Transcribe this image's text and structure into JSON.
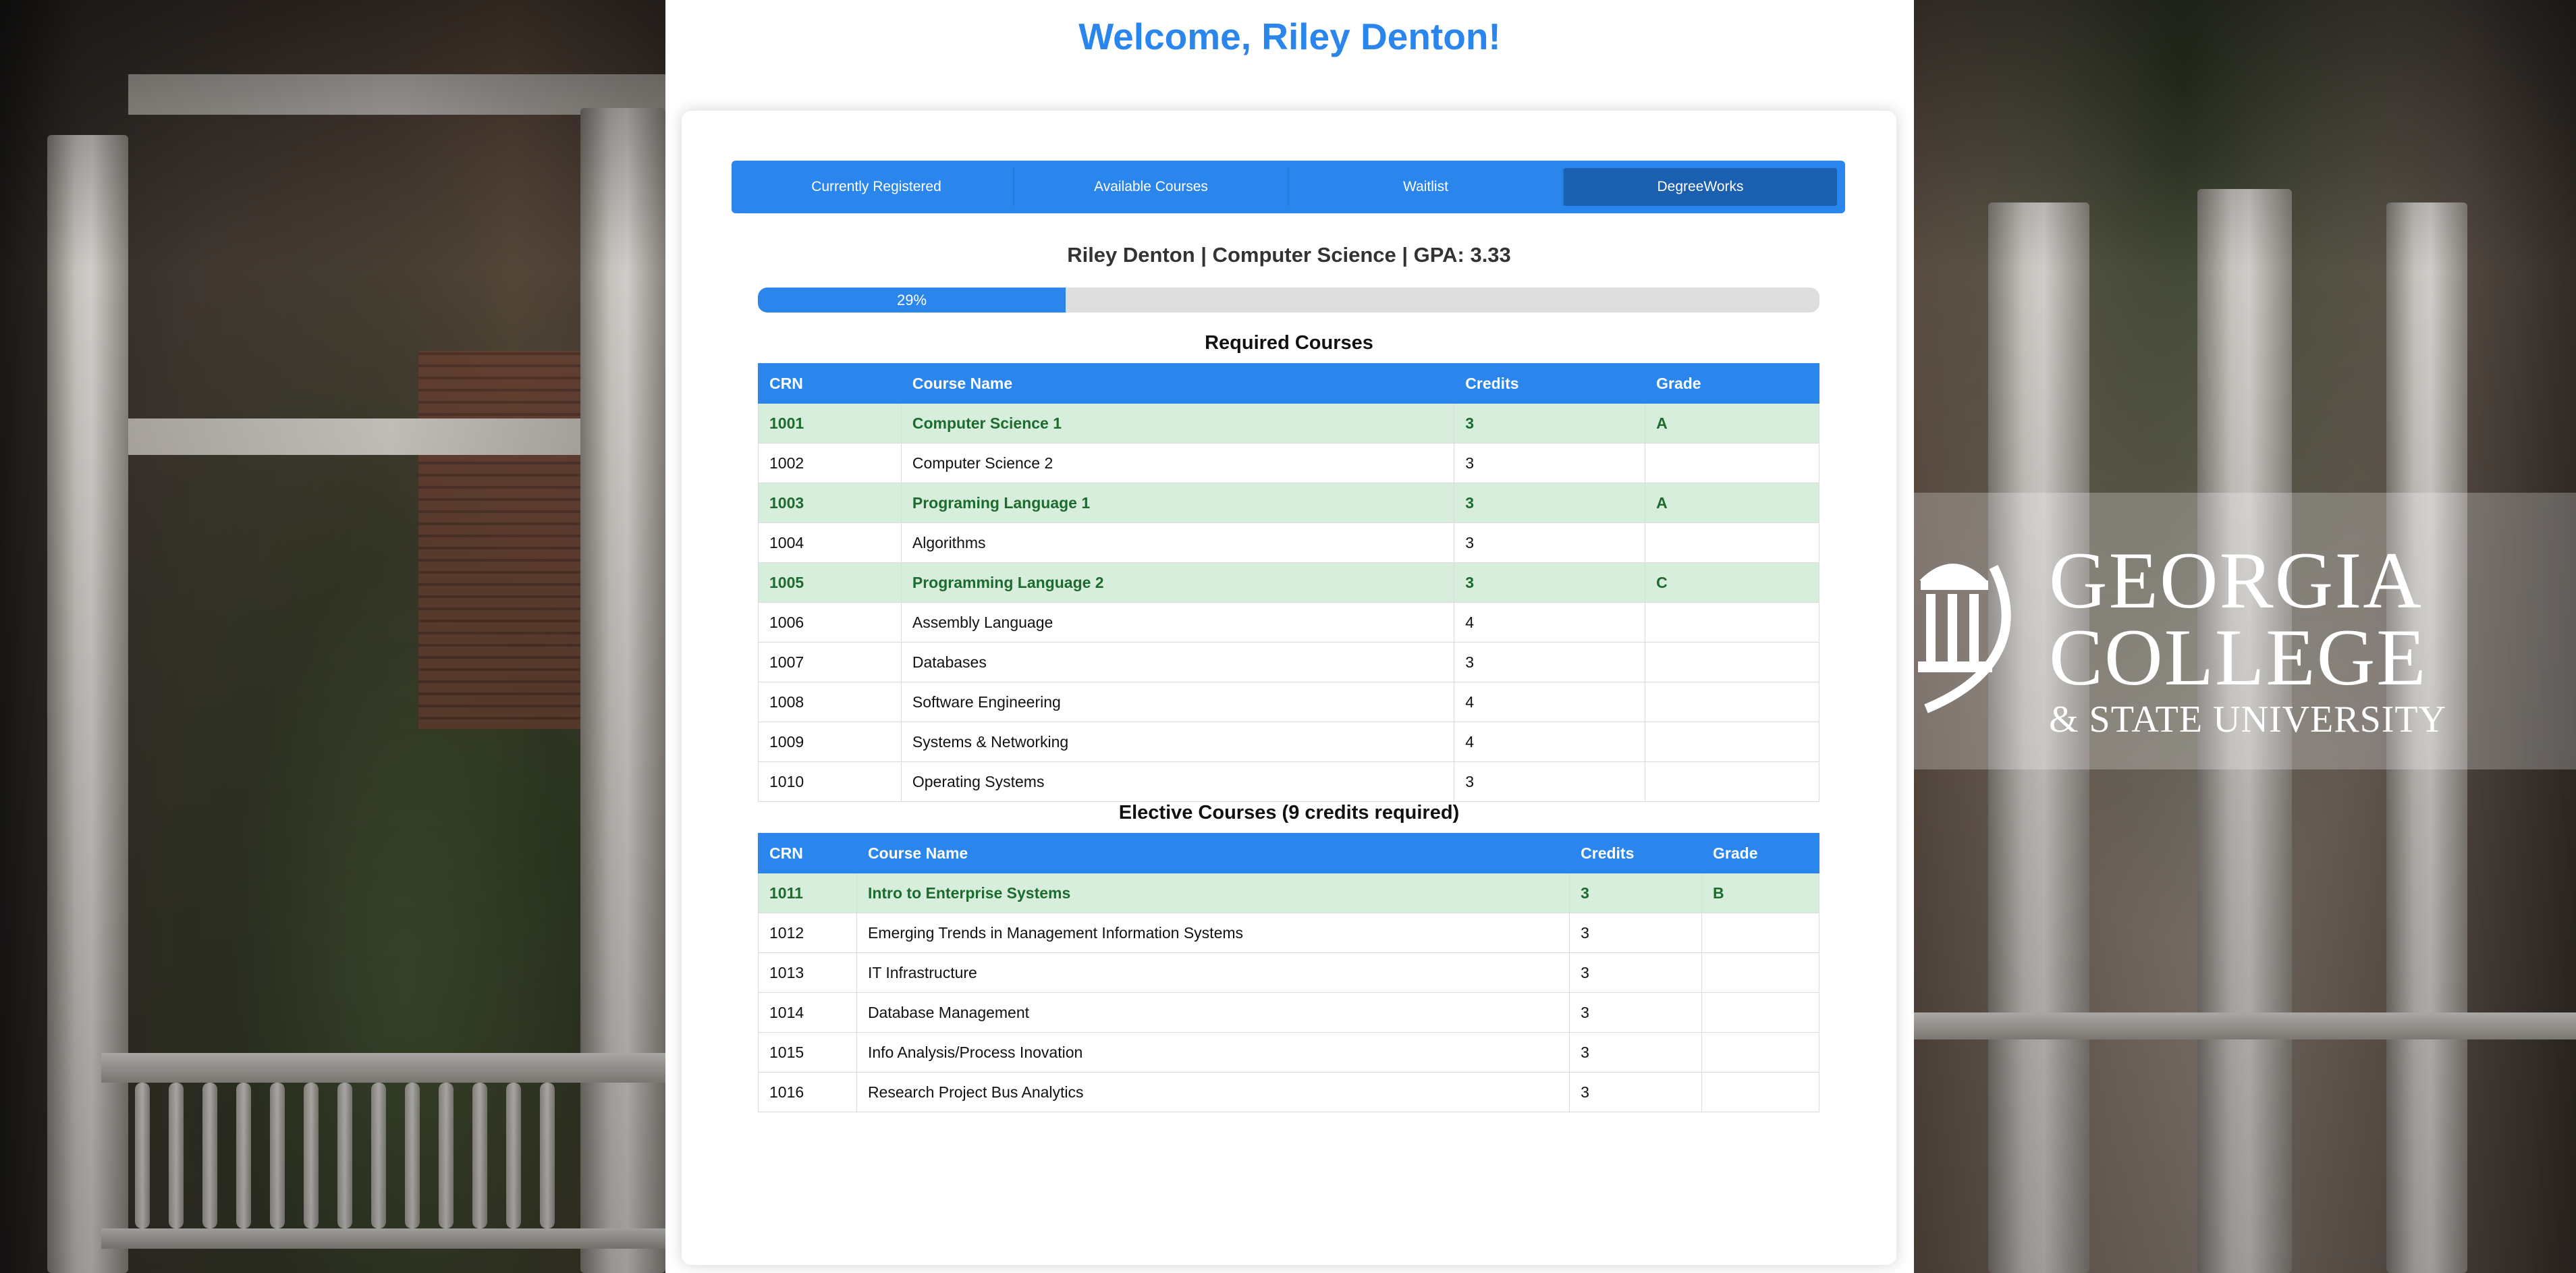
{
  "header": {
    "welcome": "Welcome, Riley Denton!"
  },
  "tabs": [
    {
      "label": "Currently Registered",
      "active": false
    },
    {
      "label": "Available Courses",
      "active": false
    },
    {
      "label": "Waitlist",
      "active": false
    },
    {
      "label": "DegreeWorks",
      "active": true
    }
  ],
  "student": {
    "summary": "Riley Denton | Computer Science | GPA: 3.33"
  },
  "progress": {
    "percent": 29,
    "label": "29%"
  },
  "required": {
    "title": "Required Courses",
    "columns": [
      "CRN",
      "Course Name",
      "Credits",
      "Grade"
    ],
    "rows": [
      {
        "crn": "1001",
        "name": "Computer Science 1",
        "credits": "3",
        "grade": "A",
        "completed": true
      },
      {
        "crn": "1002",
        "name": "Computer Science 2",
        "credits": "3",
        "grade": "",
        "completed": false
      },
      {
        "crn": "1003",
        "name": "Programing Language 1",
        "credits": "3",
        "grade": "A",
        "completed": true
      },
      {
        "crn": "1004",
        "name": "Algorithms",
        "credits": "3",
        "grade": "",
        "completed": false
      },
      {
        "crn": "1005",
        "name": "Programming Language 2",
        "credits": "3",
        "grade": "C",
        "completed": true
      },
      {
        "crn": "1006",
        "name": "Assembly Language",
        "credits": "4",
        "grade": "",
        "completed": false
      },
      {
        "crn": "1007",
        "name": "Databases",
        "credits": "3",
        "grade": "",
        "completed": false
      },
      {
        "crn": "1008",
        "name": "Software Engineering",
        "credits": "4",
        "grade": "",
        "completed": false
      },
      {
        "crn": "1009",
        "name": "Systems & Networking",
        "credits": "4",
        "grade": "",
        "completed": false
      },
      {
        "crn": "1010",
        "name": "Operating Systems",
        "credits": "3",
        "grade": "",
        "completed": false
      }
    ]
  },
  "elective": {
    "title": "Elective Courses (9 credits required)",
    "columns": [
      "CRN",
      "Course Name",
      "Credits",
      "Grade"
    ],
    "rows": [
      {
        "crn": "1011",
        "name": "Intro to Enterprise Systems",
        "credits": "3",
        "grade": "B",
        "completed": true
      },
      {
        "crn": "1012",
        "name": "Emerging Trends in Management Information Systems",
        "credits": "3",
        "grade": "",
        "completed": false
      },
      {
        "crn": "1013",
        "name": "IT Infrastructure",
        "credits": "3",
        "grade": "",
        "completed": false
      },
      {
        "crn": "1014",
        "name": "Database Management",
        "credits": "3",
        "grade": "",
        "completed": false
      },
      {
        "crn": "1015",
        "name": "Info Analysis/Process Inovation",
        "credits": "3",
        "grade": "",
        "completed": false
      },
      {
        "crn": "1016",
        "name": "Research Project Bus Analytics",
        "credits": "3",
        "grade": "",
        "completed": false
      }
    ]
  },
  "logo": {
    "line1": "GEORGIA",
    "line2": "COLLEGE",
    "line3": "& STATE UNIVERSITY"
  },
  "colors": {
    "accent": "#2a86ec",
    "tab_active": "#1b5fb0",
    "completed_row": "#d8eedc",
    "completed_text": "#1d6b2e"
  }
}
